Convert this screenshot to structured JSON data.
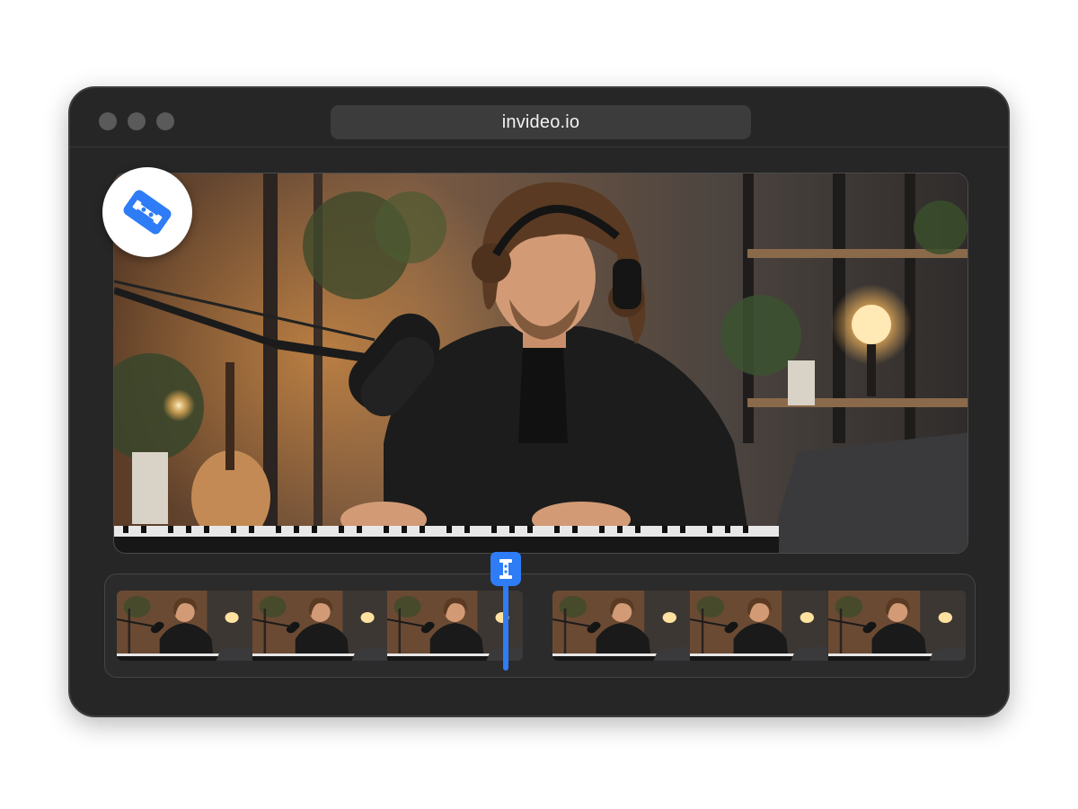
{
  "browser": {
    "url": "invideo.io"
  },
  "editor": {
    "tool_icon": "razor-blade-split-icon",
    "playhead_icon": "razor-blade-split-icon",
    "accent_color": "#2e7cf6",
    "timeline_clip_count": 2
  }
}
